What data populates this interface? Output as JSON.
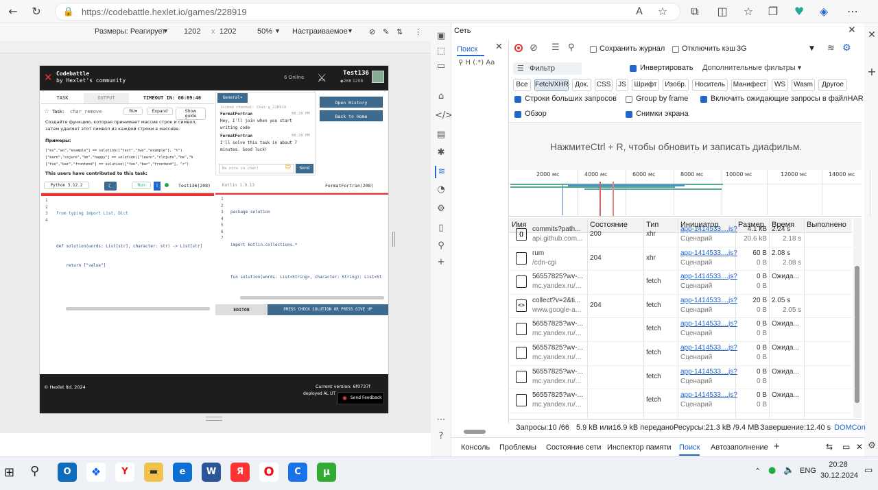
{
  "browser": {
    "url": "https://codebattle.hexlet.io/games/228919",
    "read_icon": "A",
    "star": "☆"
  },
  "devbar": {
    "size_label": "Размеры: Реагирует",
    "width": "1202",
    "height": "1202",
    "x": "x",
    "zoom": "50%",
    "throttle": "Настраиваемое"
  },
  "app": {
    "brand1": "Codebattle",
    "brand2": "by Hexlet's community",
    "online": "6 Online",
    "user": "Test136",
    "user_score": "◆268 1208",
    "tab_task": "TASK",
    "tab_output": "OUTPUT",
    "timeout": "TIMEOUT IN: 00:09:46",
    "task_label": "Task:",
    "task_name": "char_remove",
    "ru_btn": "RU▾",
    "expand_btn": "Expand",
    "guide_btn": "Show guide",
    "desc1": "Создайте функцию, которая принимает массив строк и символ,",
    "desc2": "затем удаляет этот символ из каждой строки в массиве.",
    "examples_label": "Примеры:",
    "ex1": "[\"es\",\"wo\",\"example\"]  == solution([\"test\",\"two\",\"example\"], \"t\")",
    "ex2": "[\"earn\",\"cojure\",\"be\",\"happy\"]  == solution([\"learn\",\"clojure\",\"be\",\"h",
    "ex3": "[\"foo\",\"bar\",\"frontend\"]  == solution([\"foo\",\"bar\",\"frontend\"], \"r\")",
    "contributed": "This users have contributed to this task:",
    "general": "General▾",
    "chat_joined": "Joined channel: Chat g_228919",
    "chat": [
      {
        "user": "FermatFortran",
        "time": "08:28 PM",
        "msg1": "Hey, I'll join when you start",
        "msg2": "writing code"
      },
      {
        "user": "FermatFortran",
        "time": "08:28 PM",
        "msg1": "I'll solve this task in about 7",
        "msg2": "minutes. Good luck!"
      }
    ],
    "chat_placeholder": "Be nice in chat!",
    "send": "Send",
    "open_history": "Open History",
    "back_home": "Back to Home",
    "lang_left": "Python 3.12.2",
    "run": "Run",
    "left_user": "Test136(208)",
    "lang_right": "Kotlin 1.9.13",
    "right_user": "FermatFortran(208)",
    "left_code": [
      "from typing import List, Dict",
      "",
      "def solution(words: List[str], character: str) -> List[str]",
      "    return [\"value\"]"
    ],
    "right_code": [
      "package solution",
      "",
      "import kotlin.collections.*",
      "",
      "fun solution(words: List<String>, character: String): List<St",
      "",
      "}"
    ],
    "editor_tab": "EDITOR",
    "press_check": "PRESS CHECK SOLUTION OR PRESS GIVE UP",
    "footer_copy": "© Hexlet ltd, 2024",
    "version": "Current version: 6f0737f",
    "deployed": "deployed AL UT",
    "feedback": "Send Feedback"
  },
  "devtools": {
    "title": "Сеть",
    "search_tab": "Поиск",
    "preserve": "Сохранить журнал",
    "disable_cache": "Отключить кэш",
    "throttle": "3G",
    "filter": "Фильтр",
    "invert": "Инвертировать",
    "more_filters": "Дополнительные фильтры ▾",
    "types": [
      "Все",
      "Fetch/XHR",
      "Док.",
      "CSS",
      "JS",
      "Шрифт",
      "Изобр.",
      "Носитель",
      "Манифест",
      "WS",
      "Wasm",
      "Другое"
    ],
    "opt_big": "Строки больших запросов",
    "opt_frame": "Group by frame",
    "opt_har": "Включить ожидающие запросы в файлHAR",
    "opt_overview": "Обзор",
    "opt_screens": "Снимки экрана",
    "hint": "НажмитеCtrl + R, чтобы обновить и записать диафильм.",
    "ticks": [
      "2000 мс",
      "4000 мс",
      "6000 мс",
      "8000 мс",
      "10000 мс",
      "12000 мс",
      "14000 мс"
    ],
    "columns": [
      "Имя",
      "Состояние",
      "Тип",
      "Инициатор",
      "Размер",
      "Время",
      "Выполнено"
    ],
    "rows": [
      {
        "icon": "{}",
        "name": "commits?path...",
        "domain": "api.github.com...",
        "status": "200",
        "type": "xhr",
        "init": "app-1414533....js?",
        "init2": "Сценарий",
        "size": "4.1 kB",
        "size2": "20.6 kB",
        "time": "2.24 s",
        "time2": "2.18 s"
      },
      {
        "icon": "doc",
        "name": "rum",
        "domain": "/cdn-cgi",
        "status": "204",
        "type": "xhr",
        "init": "app-1414533....js?",
        "init2": "Сценарий",
        "size": "60 B",
        "size2": "0 B",
        "time": "2.08 s",
        "time2": "2.08 s"
      },
      {
        "icon": "doc",
        "name": "56557825?wv-...",
        "domain": "mc.yandex.ru/...",
        "status": "",
        "type": "fetch",
        "init": "app-1414533....js?",
        "init2": "Сценарий",
        "size": "0 B",
        "size2": "0 B",
        "time": "Ожида...",
        "time2": ""
      },
      {
        "icon": "<>",
        "name": "collect?v=2&ti...",
        "domain": "www.google-a...",
        "status": "204",
        "type": "fetch",
        "init": "app-1414533....js?",
        "init2": "Сценарий",
        "size": "20 B",
        "size2": "0 B",
        "time": "2.05 s",
        "time2": "2.05 s"
      },
      {
        "icon": "doc",
        "name": "56557825?wv-...",
        "domain": "mc.yandex.ru/...",
        "status": "",
        "type": "fetch",
        "init": "app-1414533....js?",
        "init2": "Сценарий",
        "size": "0 B",
        "size2": "0 B",
        "time": "Ожида...",
        "time2": ""
      },
      {
        "icon": "doc",
        "name": "56557825?wv-...",
        "domain": "mc.yandex.ru/...",
        "status": "",
        "type": "fetch",
        "init": "app-1414533....js?",
        "init2": "Сценарий",
        "size": "0 B",
        "size2": "0 B",
        "time": "Ожида...",
        "time2": ""
      },
      {
        "icon": "doc",
        "name": "56557825?wv-...",
        "domain": "mc.yandex.ru/...",
        "status": "",
        "type": "fetch",
        "init": "app-1414533....js?",
        "init2": "Сценарий",
        "size": "0 B",
        "size2": "0 B",
        "time": "Ожида...",
        "time2": ""
      },
      {
        "icon": "doc",
        "name": "56557825?wv-...",
        "domain": "mc.yandex.ru/...",
        "status": "",
        "type": "fetch",
        "init": "app-1414533....js?",
        "init2": "Сценарий",
        "size": "0 B",
        "size2": "0 B",
        "time": "Ожида...",
        "time2": ""
      }
    ],
    "status_bar": {
      "requests": "Запросы:10 /66",
      "transferred": "5.9 kB или16.9 kB передано",
      "resources": "Ресурсы:21.3 kB /9.4 MB",
      "finish": "Завершение:12.40 s",
      "domcont": "DOMCon"
    },
    "bottom_tabs": [
      "Консоль",
      "Проблемы",
      "Состояние сети",
      "Инспектор памяти",
      "Поиск",
      "Автозаполнение"
    ]
  },
  "taskbar": {
    "lang": "ENG",
    "time": "20:28",
    "date": "30.12.2024"
  }
}
